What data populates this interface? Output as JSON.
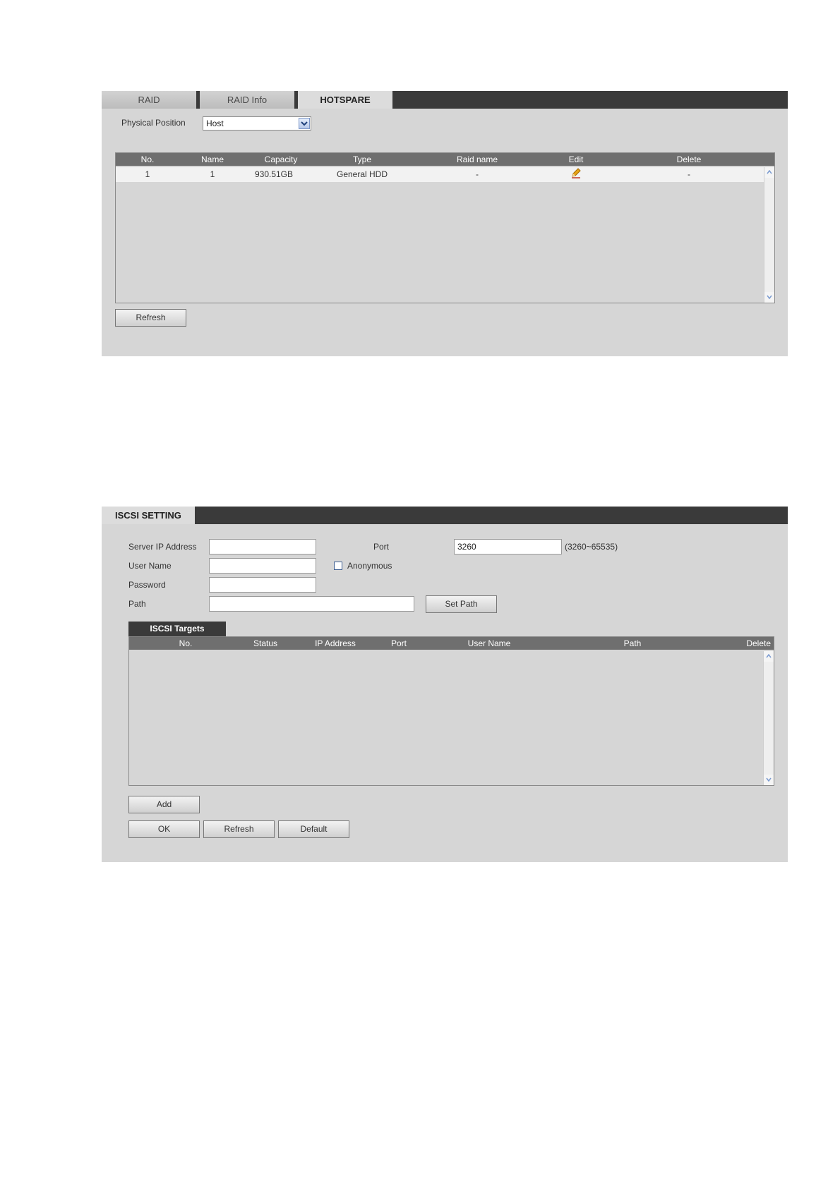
{
  "hotspare": {
    "tabs": [
      "RAID",
      "RAID Info",
      "HOTSPARE"
    ],
    "physical_position_label": "Physical Position",
    "physical_position_value": "Host",
    "columns": [
      "No.",
      "Name",
      "Capacity",
      "Type",
      "Raid name",
      "Edit",
      "Delete"
    ],
    "rows": [
      {
        "no": "1",
        "name": "1",
        "capacity": "930.51GB",
        "type": "General HDD",
        "raid_name": "-",
        "edit": "edit-pencil-icon",
        "delete": "-"
      }
    ],
    "refresh_label": "Refresh"
  },
  "iscsi": {
    "tab": "ISCSI SETTING",
    "server_ip_label": "Server IP Address",
    "server_ip_value": "",
    "port_label": "Port",
    "port_value": "3260",
    "port_range": "(3260~65535)",
    "user_name_label": "User Name",
    "user_name_value": "",
    "anonymous_label": "Anonymous",
    "anonymous_checked": false,
    "password_label": "Password",
    "password_value": "",
    "path_label": "Path",
    "path_value": "",
    "set_path_label": "Set Path",
    "targets_tab": "ISCSI Targets",
    "columns": [
      "No.",
      "Status",
      "IP Address",
      "Port",
      "User Name",
      "Path",
      "Delete"
    ],
    "add_label": "Add",
    "ok_label": "OK",
    "refresh_label": "Refresh",
    "default_label": "Default"
  },
  "colors": {
    "panel_bg": "#d6d6d6",
    "tab_bar": "#3a3a3a",
    "table_header": "#6f6f6f",
    "edit_icon": "#e8a417"
  }
}
